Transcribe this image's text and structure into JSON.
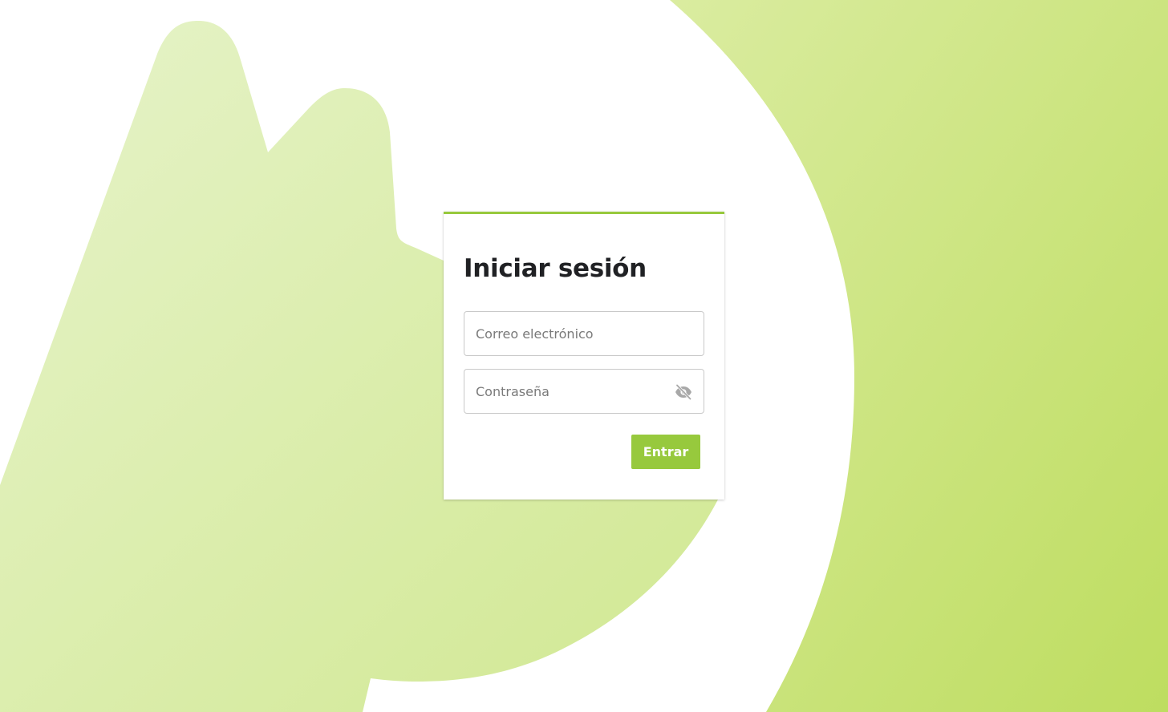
{
  "login": {
    "title": "Iniciar sesión",
    "email": {
      "placeholder": "Correo electrónico",
      "value": ""
    },
    "password": {
      "placeholder": "Contraseña",
      "value": "",
      "toggle_icon": "eye-off-icon"
    },
    "submit_label": "Entrar"
  },
  "theme": {
    "accent": "#97c93d",
    "background_light": "#e4f2c4",
    "background_dark": "#bfdd62",
    "surface": "#ffffff"
  }
}
